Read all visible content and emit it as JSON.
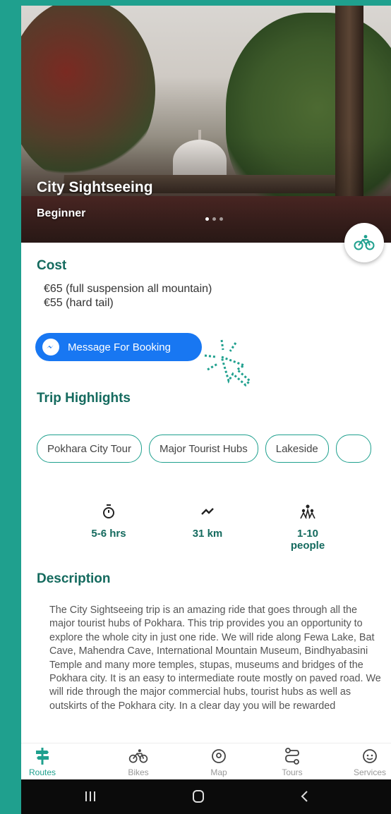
{
  "hero": {
    "title": "City Sightseeing",
    "level": "Beginner"
  },
  "cost": {
    "heading": "Cost",
    "lines": [
      "€65 (full suspension all mountain)",
      "€55 (hard tail)"
    ]
  },
  "booking_button": {
    "label": "Message For Booking"
  },
  "highlights": {
    "heading": "Trip Highlights",
    "chips": [
      "Pokhara City Tour",
      "Major Tourist Hubs",
      "Lakeside"
    ]
  },
  "stats": {
    "duration": "5-6 hrs",
    "distance": "31 km",
    "group_line1": "1-10",
    "group_line2": "people"
  },
  "description": {
    "heading": "Description",
    "text": "The City Sightseeing trip is an amazing ride that goes through all the major tourist hubs of Pokhara. This trip provides you an opportunity to explore the whole city in just one ride. We will ride along Fewa Lake, Bat Cave, Mahendra Cave, International Mountain Museum, Bindhyabasini Temple and many more temples, stupas, museums and bridges of the Pokhara city. It is an easy to intermediate route mostly on paved road. We will ride through the major commercial hubs, tourist hubs as well as outskirts of the Pokhara city. In a clear day you will be rewarded"
  },
  "nav": {
    "routes": "Routes",
    "bikes": "Bikes",
    "map": "Map",
    "tours": "Tours",
    "services": "Services"
  },
  "colors": {
    "accent": "#1fa08e",
    "heading": "#146a5e",
    "messenger": "#1877f2"
  }
}
